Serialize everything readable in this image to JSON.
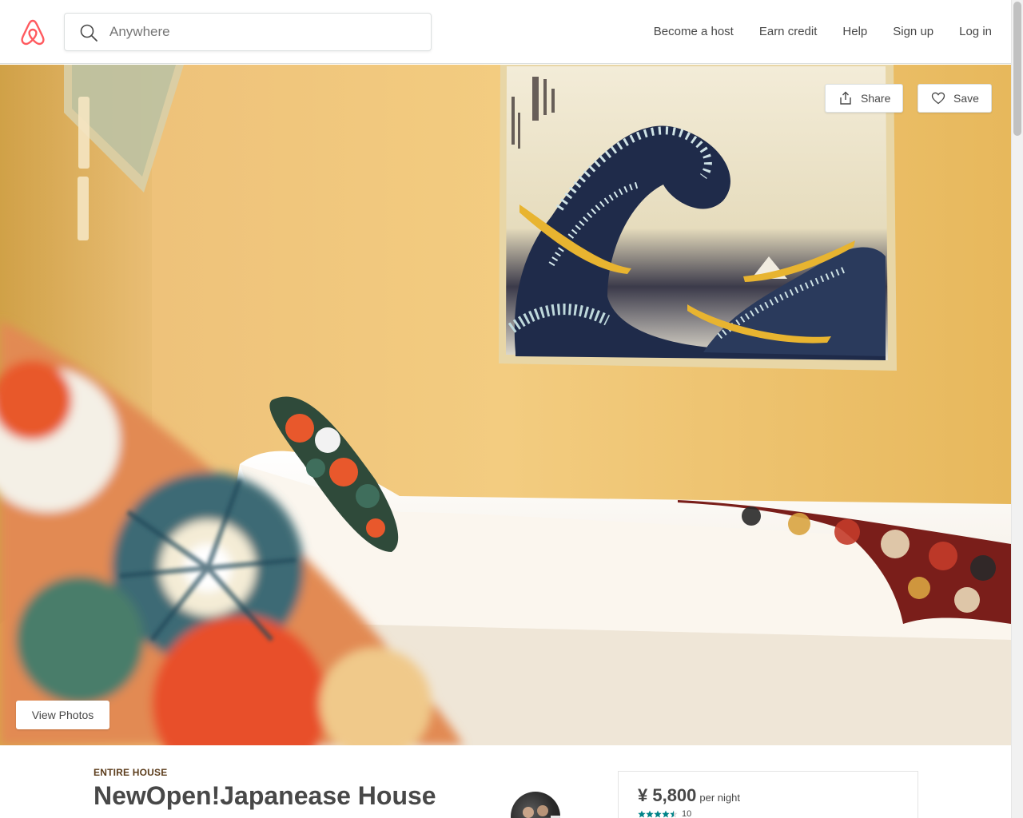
{
  "header": {
    "search_placeholder": "Anywhere",
    "nav": [
      "Become a host",
      "Earn credit",
      "Help",
      "Sign up",
      "Log in"
    ]
  },
  "hero": {
    "share_label": "Share",
    "save_label": "Save",
    "view_photos_label": "View Photos"
  },
  "listing": {
    "type": "ENTIRE HOUSE",
    "title": "NewOpen!Japanease House"
  },
  "booking": {
    "price": "¥ 5,800",
    "price_unit": "per night",
    "rating": 4.5,
    "review_count": "10"
  },
  "colors": {
    "brand": "#FF5A5F",
    "text": "#484848",
    "star": "#008489"
  },
  "icons": {
    "logo": "airbnb-logo",
    "search": "search-icon",
    "share": "share-icon",
    "save": "heart-icon",
    "star": "star-icon"
  }
}
